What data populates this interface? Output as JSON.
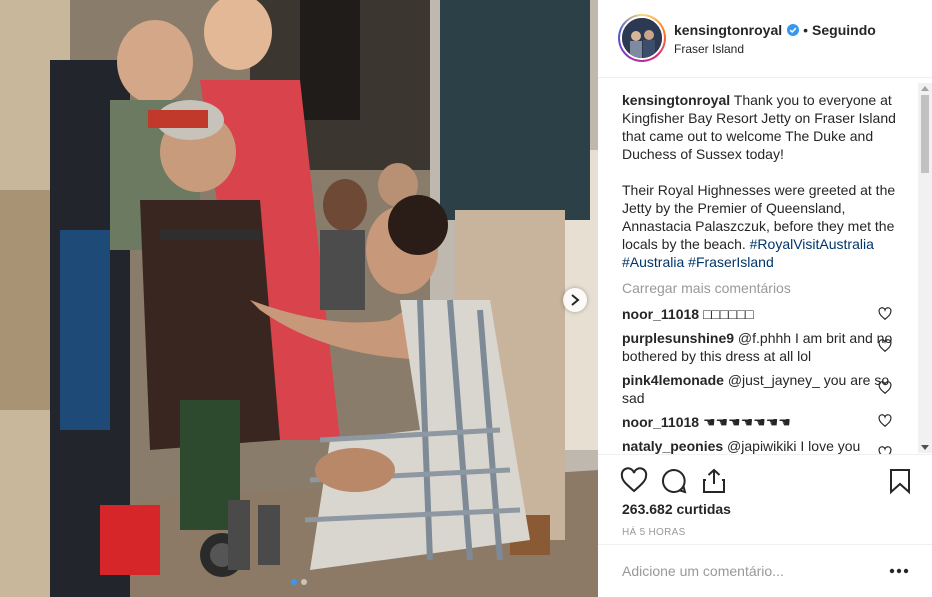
{
  "post": {
    "username": "kensingtonroyal",
    "separator": "•",
    "follow_label": "Seguindo",
    "location": "Fraser Island",
    "verified_icon": "verified-badge-icon"
  },
  "caption": {
    "username": "kensingtonroyal",
    "text_1": " Thank you to everyone at Kingfisher Bay Resort Jetty on Fraser Island that came out to welcome The Duke and Duchess of Sussex today!",
    "text_2": "Their Royal Highnesses were greeted at the Jetty by the Premier of Queensland, Annastacia Palaszczuk, before they met the locals by the beach. ",
    "hashtags": [
      "#RoyalVisitAustralia",
      "#Australia",
      "#FraserIsland"
    ]
  },
  "load_more_label": "Carregar mais comentários",
  "comments": [
    {
      "username": "noor_11018",
      "mention": "",
      "text": " □□□□□□"
    },
    {
      "username": "purplesunshine9",
      "mention": "@f.phhh",
      "text": " I am brit and no bothered by this dress at all lol"
    },
    {
      "username": "pink4lemonade",
      "mention": "@just_jayney_",
      "text": " you are so sad"
    },
    {
      "username": "noor_11018",
      "mention": "",
      "text": " ☚☚☚☚☚☚☚"
    },
    {
      "username": "nataly_peonies",
      "mention": "@japiwikiki",
      "text": " I love you"
    }
  ],
  "likes_label": "263.682 curtidas",
  "time_label": "HÁ 5 HORAS",
  "add_comment_placeholder": "Adicione um comentário...",
  "colors": {
    "link": "#003569",
    "verified": "#3897f0",
    "active_dot": "#3897f0",
    "muted": "#999999"
  },
  "carousel": {
    "total": 2,
    "active_index": 0
  }
}
